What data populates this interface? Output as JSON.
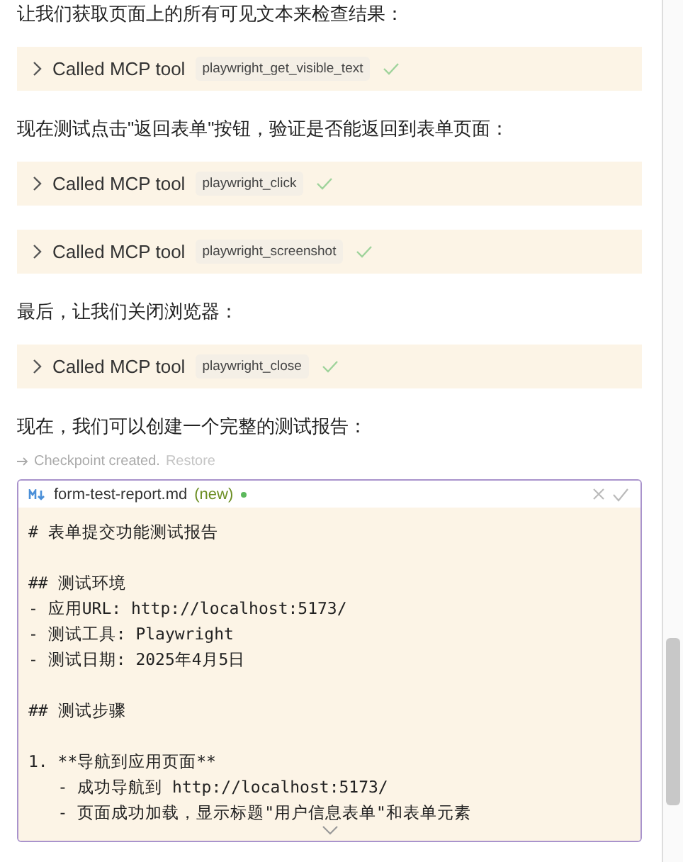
{
  "messages": [
    {
      "kind": "text",
      "text": "让我们获取页面上的所有可见文本来检查结果："
    },
    {
      "kind": "tool",
      "label": "Called MCP tool",
      "tool": "playwright_get_visible_text",
      "done": true
    },
    {
      "kind": "text",
      "text": "现在测试点击\"返回表单\"按钮，验证是否能返回到表单页面："
    },
    {
      "kind": "tool",
      "label": "Called MCP tool",
      "tool": "playwright_click",
      "done": true
    },
    {
      "kind": "tool",
      "label": "Called MCP tool",
      "tool": "playwright_screenshot",
      "done": true
    },
    {
      "kind": "text",
      "text": "最后，让我们关闭浏览器："
    },
    {
      "kind": "tool",
      "label": "Called MCP tool",
      "tool": "playwright_close",
      "done": true
    },
    {
      "kind": "text",
      "text": "现在，我们可以创建一个完整的测试报告："
    }
  ],
  "checkpoint": {
    "text": "Checkpoint created.",
    "link": "Restore"
  },
  "file": {
    "name": "form-test-report.md",
    "status": "(new)",
    "code": "# 表单提交功能测试报告\n\n## 测试环境\n- 应用URL: http://localhost:5173/\n- 测试工具: Playwright\n- 测试日期: 2025年4月5日\n\n## 测试步骤\n\n1. **导航到应用页面**\n   - 成功导航到 http://localhost:5173/\n   - 页面成功加载，显示标题\"用户信息表单\"和表单元素"
  }
}
